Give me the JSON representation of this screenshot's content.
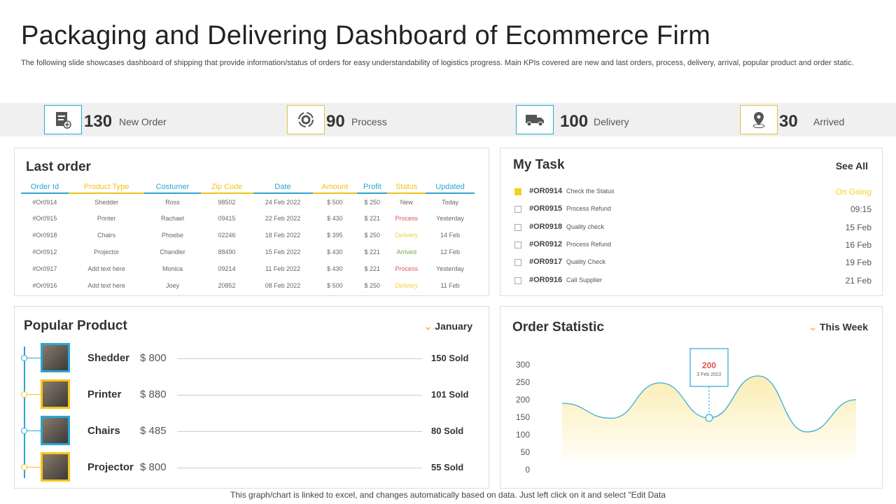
{
  "title": "Packaging and Delivering Dashboard of Ecommerce Firm",
  "description": "The following slide showcases dashboard of shipping that provide information/status of orders for easy understandability of logistics progress. Main KPIs covered are new and last orders, process, delivery, arrival, popular product and order static.",
  "kpis": [
    {
      "value": "130",
      "label": "New Order",
      "icon": "order-form-icon",
      "color": "#29a7d1"
    },
    {
      "value": "90",
      "label": "Process",
      "icon": "gear-cycle-icon",
      "color": "#e0c040"
    },
    {
      "value": "100",
      "label": "Delivery",
      "icon": "truck-icon",
      "color": "#29a7d1"
    },
    {
      "value": "30",
      "label": "Arrived",
      "icon": "location-pin-icon",
      "color": "#e0c040"
    }
  ],
  "last_order": {
    "title": "Last order",
    "headers": [
      "Order Id",
      "Product Type",
      "Costumer",
      "Zip Code",
      "Date",
      "Amount",
      "Profit",
      "Status",
      "Updated"
    ],
    "rows": [
      [
        "#Or0914",
        "Shedder",
        "Ross",
        "98502",
        "24 Feb 2022",
        "$ 500",
        "$ 250",
        "New",
        "Today"
      ],
      [
        "#Or0915",
        "Printer",
        "Rachael",
        "09415",
        "22 Feb 2022",
        "$ 430",
        "$ 221",
        "Process",
        "Yesterday"
      ],
      [
        "#Or0918",
        "Chairs",
        "Phoebe",
        "02246",
        "18 Feb 2022",
        "$ 395",
        "$ 250",
        "Delivery",
        "14 Feb"
      ],
      [
        "#Or0912",
        "Projector",
        "Chandler",
        "88490",
        "15 Feb 2022",
        "$ 430",
        "$ 221",
        "Arrived",
        "12 Feb"
      ],
      [
        "#Or0917",
        "Add text here",
        "Monica",
        "09214",
        "11 Feb 2022",
        "$ 430",
        "$ 221",
        "Process",
        "Yesterday"
      ],
      [
        "#Or0916",
        "Add text here",
        "Joey",
        "20852",
        "08 Feb 2022",
        "$ 500",
        "$ 250",
        "Delivery",
        "11 Feb"
      ]
    ],
    "status_colors": {
      "New": "#666666",
      "Process": "#e05555",
      "Delivery": "#f0d040",
      "Arrived": "#6ab04c"
    }
  },
  "my_task": {
    "title": "My Task",
    "see_all": "See All",
    "items": [
      {
        "id": "#OR0914",
        "name": "Check the Status",
        "when": "On Going",
        "checked": true
      },
      {
        "id": "#OR0915",
        "name": "Process Refund",
        "when": "09:15",
        "checked": false
      },
      {
        "id": "#OR0918",
        "name": "Quality check",
        "when": "15 Feb",
        "checked": false
      },
      {
        "id": "#OR0912",
        "name": "Process Refund",
        "when": "16 Feb",
        "checked": false
      },
      {
        "id": "#OR0917",
        "name": "Quality Check",
        "when": "19 Feb",
        "checked": false
      },
      {
        "id": "#OR0916",
        "name": "Call Supplier",
        "when": "21 Feb",
        "checked": false
      }
    ]
  },
  "popular": {
    "title": "Popular Product",
    "period": "January",
    "items": [
      {
        "name": "Shedder",
        "price": "$ 800",
        "sold": "150 Sold",
        "color": "#29a7d1"
      },
      {
        "name": "Printer",
        "price": "$ 880",
        "sold": "101 Sold",
        "color": "#f5c518"
      },
      {
        "name": "Chairs",
        "price": "$ 485",
        "sold": "80 Sold",
        "color": "#29a7d1"
      },
      {
        "name": "Projector",
        "price": "$ 800",
        "sold": "55 Sold",
        "color": "#f5c518"
      }
    ]
  },
  "chart_data": {
    "type": "area",
    "title": "Order Statistic",
    "period": "This Week",
    "yticks": [
      0,
      50,
      100,
      150,
      200,
      250,
      300
    ],
    "ylim": [
      0,
      300
    ],
    "values": [
      190,
      147,
      248,
      148,
      268,
      108,
      200
    ],
    "annotation": {
      "value": "200",
      "date": "3 Feb 2022",
      "index": 3
    }
  },
  "footer": "This graph/chart is linked to excel,  and changes automatically based on data. Just left click on it and select \"Edit Data"
}
